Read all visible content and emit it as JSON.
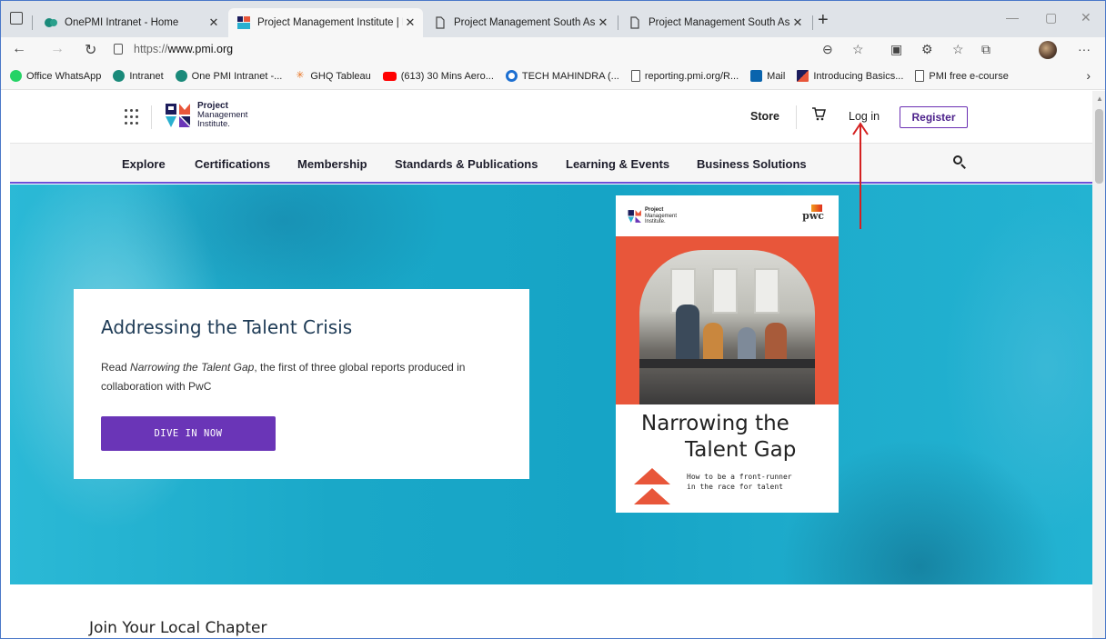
{
  "browser": {
    "tabs": [
      {
        "title": "OnePMI Intranet - Home",
        "active": false
      },
      {
        "title": "Project Management Institute | P",
        "active": true
      },
      {
        "title": "Project Management South Asia",
        "active": false
      },
      {
        "title": "Project Management South Asia",
        "active": false
      }
    ],
    "url_scheme": "https://",
    "url_host": "www.pmi.org",
    "bookmarks": [
      {
        "label": "Office WhatsApp",
        "color": "#25d366"
      },
      {
        "label": "Intranet",
        "color": "#1a8a7a"
      },
      {
        "label": "One PMI Intranet -...",
        "color": "#1a8a7a"
      },
      {
        "label": "GHQ Tableau",
        "color": "#e97627"
      },
      {
        "label": "(613) 30 Mins Aero...",
        "color": "#ff0000"
      },
      {
        "label": "TECH MAHINDRA (...",
        "color": "#1c6fd1"
      },
      {
        "label": "reporting.pmi.org/R...",
        "color": "#888888"
      },
      {
        "label": "Mail",
        "color": "#0a64ad"
      },
      {
        "label": "Introducing Basics...",
        "color": "#6b2fb3"
      },
      {
        "label": "PMI free e-course",
        "color": "#888888"
      }
    ]
  },
  "header": {
    "logo_line1": "Project",
    "logo_line2": "Management",
    "logo_line3": "Institute.",
    "store": "Store",
    "login": "Log in",
    "register": "Register"
  },
  "nav": {
    "items": [
      "Explore",
      "Certifications",
      "Membership",
      "Standards & Publications",
      "Learning & Events",
      "Business Solutions"
    ]
  },
  "hero": {
    "title": "Addressing the Talent Crisis",
    "body_prefix": "Read ",
    "body_italic": "Narrowing the Talent Gap",
    "body_suffix": ", the first of three global reports produced in collaboration with PwC",
    "cta": "DIVE IN NOW"
  },
  "cover": {
    "logo_line1": "Project",
    "logo_line2": "Management",
    "logo_line3": "Institute.",
    "partner": "pwc",
    "title_line1": "Narrowing the",
    "title_line2": "Talent Gap",
    "subtitle": "How to be a front-runner\nin the race for talent"
  },
  "section": {
    "title": "Join Your Local Chapter"
  },
  "colors": {
    "brand_purple": "#6a35b7",
    "hero_cyan": "#1aa8c8",
    "annotation_red": "#d42020",
    "cover_orange": "#e8563a"
  }
}
